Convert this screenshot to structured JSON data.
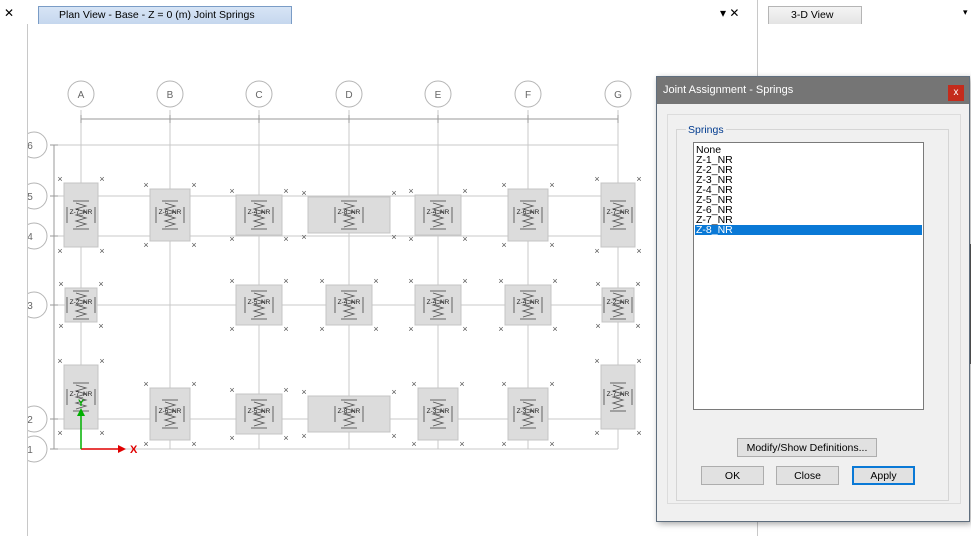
{
  "tabs": {
    "plan_view": "Plan View - Base - Z = 0 (m)  Joint Springs",
    "three_d_view": "3-D View",
    "tab_controls": "▾ ✕",
    "left_close": "✕",
    "three_d_dropdown": "▾"
  },
  "grid": {
    "columns": [
      "A",
      "B",
      "C",
      "D",
      "E",
      "F",
      "G"
    ],
    "rows": [
      "6",
      "5",
      "4",
      "3",
      "2",
      "1"
    ]
  },
  "axes": {
    "x": "X",
    "y": "Y"
  },
  "springs": [
    {
      "label": "Z-7_NR",
      "col": "A",
      "row": "5"
    },
    {
      "label": "Z-6_NR",
      "col": "B",
      "row": "5"
    },
    {
      "label": "Z-4_NR",
      "col": "C",
      "row": "5"
    },
    {
      "label": "Z-8_NR",
      "col": "D",
      "row": "5"
    },
    {
      "label": "Z-4_NR",
      "col": "E",
      "row": "5"
    },
    {
      "label": "Z-6_NR",
      "col": "F",
      "row": "5"
    },
    {
      "label": "Z-7_NR",
      "col": "G",
      "row": "5"
    },
    {
      "label": "Z-2_NR",
      "col": "A",
      "row": "3"
    },
    {
      "label": "Z-5_NR",
      "col": "C",
      "row": "3"
    },
    {
      "label": "Z-4_NR",
      "col": "D",
      "row": "3"
    },
    {
      "label": "Z-4_NR",
      "col": "E",
      "row": "3"
    },
    {
      "label": "Z-4_NR",
      "col": "F",
      "row": "3"
    },
    {
      "label": "Z-2_NR",
      "col": "G",
      "row": "3"
    },
    {
      "label": "Z-7_NR",
      "col": "A",
      "row": "2"
    },
    {
      "label": "Z-6_NR",
      "col": "B",
      "row": "2"
    },
    {
      "label": "Z-5_NR",
      "col": "C",
      "row": "2"
    },
    {
      "label": "Z-8_NR",
      "col": "D",
      "row": "2"
    },
    {
      "label": "Z-3_NR",
      "col": "E",
      "row": "2"
    },
    {
      "label": "Z-3_NR",
      "col": "F",
      "row": "2"
    },
    {
      "label": "Z-7_NR",
      "col": "G",
      "row": "2"
    }
  ],
  "dialog": {
    "title": "Joint Assignment - Springs",
    "close_glyph": "x",
    "group_label": "Springs",
    "items": [
      "None",
      "Z-1_NR",
      "Z-2_NR",
      "Z-3_NR",
      "Z-4_NR",
      "Z-5_NR",
      "Z-6_NR",
      "Z-7_NR",
      "Z-8_NR"
    ],
    "selected": "Z-8_NR",
    "modify_button": "Modify/Show Definitions...",
    "ok_button": "OK",
    "close_button": "Close",
    "apply_button": "Apply"
  },
  "colors": {
    "selection": "#0a79d6",
    "dialog_title_bar": "#757575",
    "close_button": "#c42b1c",
    "x_axis": "#e00000",
    "y_axis": "#00b000",
    "footing": "#dcdcdc"
  }
}
